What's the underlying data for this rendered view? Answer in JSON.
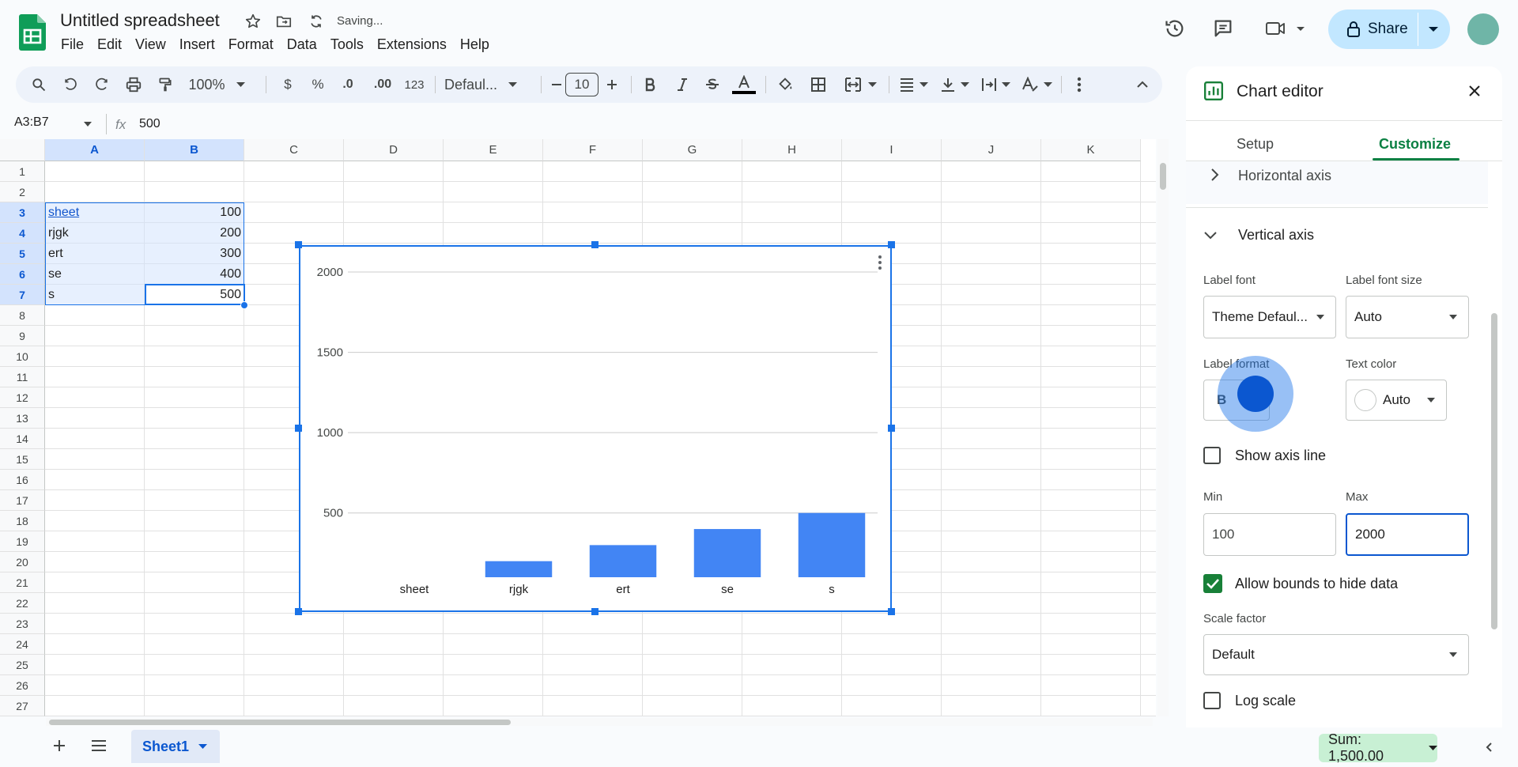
{
  "header": {
    "doc_title": "Untitled spreadsheet",
    "saving_status": "Saving...",
    "menu": [
      "File",
      "Edit",
      "View",
      "Insert",
      "Format",
      "Data",
      "Tools",
      "Extensions",
      "Help"
    ],
    "share_label": "Share"
  },
  "toolbar": {
    "zoom": "100%",
    "currency": "$",
    "percent": "%",
    "decrease_decimal": ".0",
    "increase_decimal": ".00",
    "number_format": "123",
    "font": "Defaul...",
    "font_size": "10",
    "bold": "B"
  },
  "formula_bar": {
    "name_box": "A3:B7",
    "fx": "fx",
    "value": "500"
  },
  "sheet": {
    "columns": [
      "A",
      "B",
      "C",
      "D",
      "E",
      "F",
      "G",
      "H",
      "I",
      "J",
      "K"
    ],
    "rows": [
      "1",
      "2",
      "3",
      "4",
      "5",
      "6",
      "7",
      "8",
      "9",
      "10",
      "11",
      "12",
      "13",
      "14",
      "15",
      "16",
      "17",
      "18",
      "19",
      "20",
      "21",
      "22",
      "23",
      "24",
      "25",
      "26",
      "27"
    ],
    "data": [
      {
        "label": "sheet",
        "value": "100"
      },
      {
        "label": "rjgk",
        "value": "200"
      },
      {
        "label": "ert",
        "value": "300"
      },
      {
        "label": "se",
        "value": "400"
      },
      {
        "label": "s",
        "value": "500"
      }
    ]
  },
  "chart_data": {
    "type": "bar",
    "categories": [
      "sheet",
      "rjgk",
      "ert",
      "se",
      "s"
    ],
    "values": [
      100,
      200,
      300,
      400,
      500
    ],
    "yticks": [
      "2000",
      "1500",
      "1000",
      "500"
    ],
    "ylim": [
      100,
      2000
    ],
    "grid": true
  },
  "panel": {
    "title": "Chart editor",
    "tab_setup": "Setup",
    "tab_customize": "Customize",
    "section_horizontal": "Horizontal axis",
    "section_vertical": "Vertical axis",
    "label_font_label": "Label font",
    "label_font_value": "Theme Defaul...",
    "label_font_size_label": "Label font size",
    "label_font_size_value": "Auto",
    "label_format_label": "Label format",
    "label_format_bold": "B",
    "text_color_label": "Text color",
    "text_color_value": "Auto",
    "show_axis_line": "Show axis line",
    "min_label": "Min",
    "min_value": "100",
    "max_label": "Max",
    "max_value": "2000",
    "allow_bounds": "Allow bounds to hide data",
    "scale_factor_label": "Scale factor",
    "scale_factor_value": "Default",
    "log_scale": "Log scale"
  },
  "bottom": {
    "sheet_tab": "Sheet1",
    "sum": "Sum: 1,500.00"
  },
  "colors": {
    "accent": "#1a73e8",
    "bar": "#4285f4",
    "selection": "#d3e3fd",
    "share_bg": "#c2e7ff",
    "checkbox_checked": "#188038",
    "sum_bg": "#c8f0d4"
  }
}
